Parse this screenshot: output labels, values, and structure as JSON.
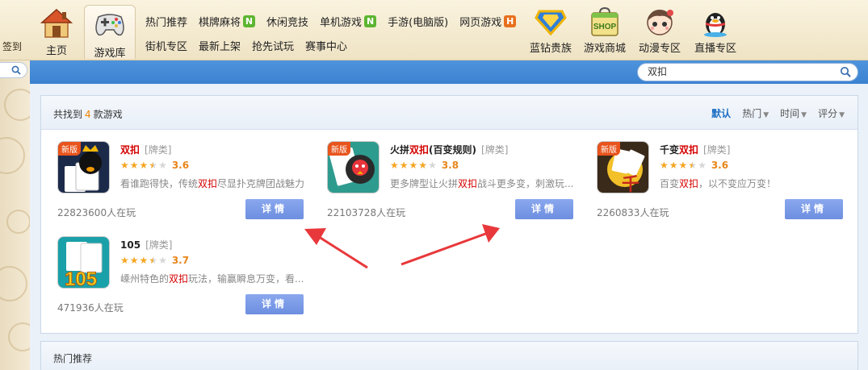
{
  "sidebar": {
    "signin": "签到"
  },
  "nav": {
    "home": "主页",
    "library": "游戏库",
    "submenu_row1": [
      {
        "label": "热门推荐",
        "badge": ""
      },
      {
        "label": "棋牌麻将",
        "badge": "N",
        "badge_color": "#5cb531"
      },
      {
        "label": "休闲竞技",
        "badge": ""
      },
      {
        "label": "单机游戏",
        "badge": "N",
        "badge_color": "#5cb531"
      },
      {
        "label": "手游(电脑版)",
        "badge": ""
      },
      {
        "label": "网页游戏",
        "badge": "H",
        "badge_color": "#e8701c"
      }
    ],
    "submenu_row2": [
      {
        "label": "街机专区"
      },
      {
        "label": "最新上架"
      },
      {
        "label": "抢先试玩"
      },
      {
        "label": "赛事中心"
      }
    ],
    "right": [
      {
        "label": "蓝钻贵族",
        "icon": "blue-diamond-icon"
      },
      {
        "label": "游戏商城",
        "icon": "shop-bag-icon"
      },
      {
        "label": "动漫专区",
        "icon": "anime-character-icon"
      },
      {
        "label": "直播专区",
        "icon": "qq-penguin-icon"
      }
    ]
  },
  "search": {
    "query": "双扣"
  },
  "results": {
    "prefix": "共找到",
    "count": "4",
    "suffix": "款游戏",
    "sorts": [
      {
        "label": "默认",
        "active": true
      },
      {
        "label": "热门",
        "active": false
      },
      {
        "label": "时间",
        "active": false
      },
      {
        "label": "评分",
        "active": false
      }
    ]
  },
  "games": [
    {
      "name_pre": "",
      "name_hl": "双扣",
      "name_post": "",
      "category": "[牌类]",
      "stars": 3.5,
      "score": "3.6",
      "desc_pre": "看谁跑得快，传统",
      "desc_hl": "双扣",
      "desc_post": "尽显扑克牌团战魅力",
      "players": "22823600人在玩",
      "is_new": true,
      "badge": "新版",
      "button": "详情"
    },
    {
      "name_pre": "火拼",
      "name_hl": "双扣",
      "name_post": "(百变规则)",
      "category": "[牌类]",
      "stars": 4,
      "score": "3.8",
      "desc_pre": "更多牌型让火拼",
      "desc_hl": "双扣",
      "desc_post": "战斗更多变，刺激玩...",
      "players": "22103728人在玩",
      "is_new": true,
      "badge": "新版",
      "button": "详情"
    },
    {
      "name_pre": "千变",
      "name_hl": "双扣",
      "name_post": "",
      "category": "[牌类]",
      "stars": 3.5,
      "score": "3.6",
      "desc_pre": "百变",
      "desc_hl": "双扣",
      "desc_post": "，以不变应万变！",
      "players": "2260833人在玩",
      "is_new": true,
      "badge": "新版",
      "button": "详情"
    },
    {
      "name_pre": "105",
      "name_hl": "",
      "name_post": "",
      "category": "[牌类]",
      "stars": 3.5,
      "score": "3.7",
      "desc_pre": "嵊州特色的",
      "desc_hl": "双扣",
      "desc_post": "玩法，输赢瞬息万变，看...",
      "players": "471936人在玩",
      "is_new": false,
      "badge": "",
      "button": "详情"
    }
  ],
  "hot_section": {
    "title": "热门推荐"
  },
  "colors": {
    "accent_blue": "#3b82d1",
    "highlight_red": "#d40000",
    "score_orange": "#e8861a",
    "button_blue": "#7596e6"
  }
}
